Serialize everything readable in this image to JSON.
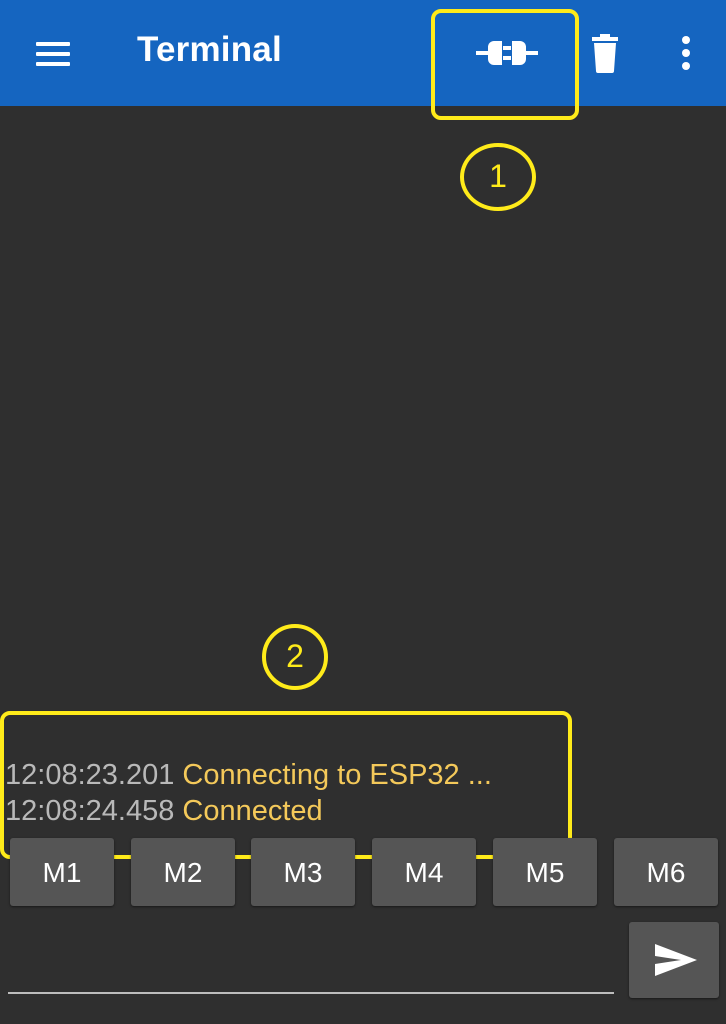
{
  "appbar": {
    "title": "Terminal",
    "icons": {
      "menu": "hamburger-menu-icon",
      "connect": "plug-connect-icon",
      "delete": "trash-icon",
      "overflow": "more-vertical-icon"
    },
    "color": "#1565c0"
  },
  "annotations": {
    "marker_1": "1",
    "marker_2": "2",
    "color": "#ffeb1a"
  },
  "log": [
    {
      "time": "12:08:23.201",
      "message": "Connecting to ESP32 ..."
    },
    {
      "time": "12:08:24.458",
      "message": "Connected"
    }
  ],
  "macros": [
    "M1",
    "M2",
    "M3",
    "M4",
    "M5",
    "M6"
  ],
  "input": {
    "value": "",
    "placeholder": ""
  },
  "send_icon": "send-icon",
  "colors": {
    "background": "#2f2f2f",
    "timestamp": "#b9b9b9",
    "message": "#f4c95a",
    "button": "#555555"
  }
}
